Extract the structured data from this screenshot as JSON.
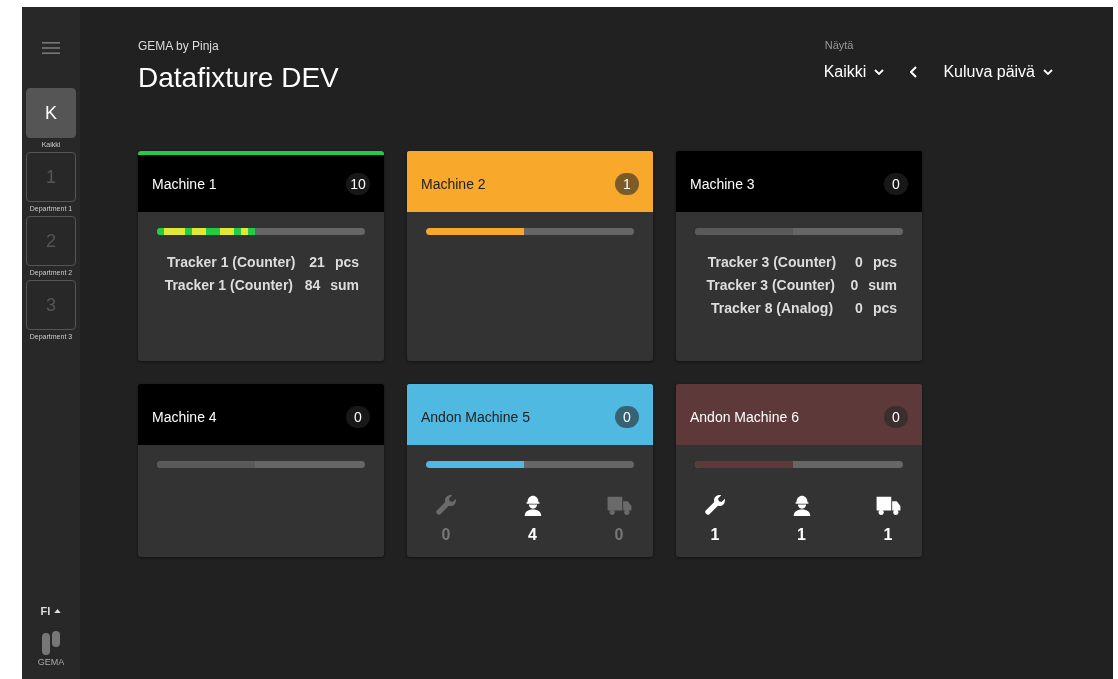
{
  "sidebar": {
    "items": [
      {
        "letter": "K",
        "label": "Kaikki",
        "selected": true
      },
      {
        "letter": "1",
        "label": "Department 1",
        "selected": false
      },
      {
        "letter": "2",
        "label": "Department 2",
        "selected": false
      },
      {
        "letter": "3",
        "label": "Department 3",
        "selected": false
      }
    ],
    "language": "FI",
    "logo_text": "GEMA"
  },
  "header": {
    "subtitle": "GEMA by Pinja",
    "title": "Datafixture DEV",
    "filter_label": "Näytä",
    "filter_value": "Kaikki",
    "period": "Kuluva päivä"
  },
  "machines": [
    {
      "kind": "tracker",
      "name": "Machine 1",
      "count": "10",
      "color": "#000000",
      "running": true,
      "progress": {
        "level": 0.47,
        "segments": [
          {
            "color": "#22cc44"
          },
          {
            "color": "#e1e836"
          },
          {
            "color": "#e1e836"
          },
          {
            "color": "#e1e836"
          },
          {
            "color": "#22cc44"
          },
          {
            "color": "#e1e836"
          },
          {
            "color": "#e1e836"
          },
          {
            "color": "#22cc44"
          },
          {
            "color": "#22cc44"
          },
          {
            "color": "#e1e836"
          },
          {
            "color": "#e1e836"
          },
          {
            "color": "#22cc44"
          },
          {
            "color": "#e1e836"
          },
          {
            "color": "#22cc44"
          }
        ]
      },
      "trackers": [
        {
          "name": "Tracker 1 (Counter)",
          "value": "21",
          "unit": "pcs"
        },
        {
          "name": "Tracker 1 (Counter)",
          "value": "84",
          "unit": "sum"
        }
      ]
    },
    {
      "kind": "tracker",
      "name": "Machine 2",
      "count": "1",
      "color": "#f8a82a",
      "progress": {
        "level": 0.47,
        "color": "#f8a82a"
      }
    },
    {
      "kind": "tracker",
      "name": "Machine 3",
      "count": "0",
      "color": "#000000",
      "progress": {
        "level": 0.47,
        "color": "#5a5a5a"
      },
      "trackers": [
        {
          "name": "Tracker 3 (Counter)",
          "value": "0",
          "unit": "pcs"
        },
        {
          "name": "Tracker 3 (Counter)",
          "value": "0",
          "unit": "sum"
        },
        {
          "name": "Tracker 8 (Analog)",
          "value": "0",
          "unit": "pcs"
        }
      ]
    },
    {
      "kind": "tracker",
      "name": "Machine 4",
      "count": "0",
      "color": "#000000",
      "progress": {
        "level": 0.47,
        "color": "#5a5a5a"
      }
    },
    {
      "kind": "andon",
      "name": "Andon Machine 5",
      "count": "0",
      "color": "#4fb9e1",
      "progress": {
        "level": 0.47,
        "color": "#4fb9e1"
      },
      "counters": [
        {
          "kind": "wrench",
          "value": "0",
          "active": false
        },
        {
          "kind": "worker",
          "value": "4",
          "active": true
        },
        {
          "kind": "truck",
          "value": "0",
          "active": false
        }
      ]
    },
    {
      "kind": "andon",
      "name": "Andon Machine 6",
      "count": "0",
      "color": "#5e3939",
      "progress": {
        "level": 0.47,
        "color": "#5e3939"
      },
      "counters": [
        {
          "kind": "wrench",
          "value": "1",
          "active": true
        },
        {
          "kind": "worker",
          "value": "1",
          "active": true
        },
        {
          "kind": "truck",
          "value": "1",
          "active": true
        }
      ]
    }
  ]
}
